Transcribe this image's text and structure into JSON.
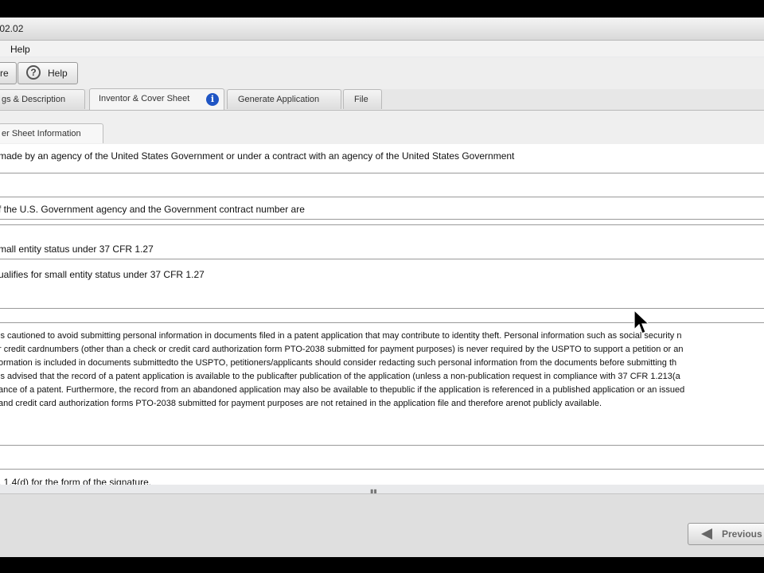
{
  "window": {
    "title": ".02.02"
  },
  "menu": {
    "help": "Help"
  },
  "toolbar": {
    "partial_button": "re",
    "help_button": "Help",
    "help_glyph": "?"
  },
  "tabs": {
    "drawings": "gs & Description",
    "inventor": "Inventor & Cover Sheet",
    "generate": "Generate Application",
    "file": "File",
    "info_glyph": "i"
  },
  "subtab": {
    "label": "er Sheet Information"
  },
  "content": {
    "gov_statement": "made by an agency of the United States Government or under a contract with an agency of the United States Government",
    "gov_agency": "f the U.S. Government agency and the Government contract number are",
    "small_entity": "mall entity status under 37 CFR 1.27",
    "qualifies": "ualifies for small entity status under 37 CFR 1.27",
    "privacy": [
      " is cautioned to avoid submitting personal information in documents filed in a patent application that may contribute to identity theft. Personal information such as social security n",
      "r credit cardnumbers (other than a check or credit card authorization form PTO-2038 submitted for payment purposes) is never required by the USPTO to support a petition or an",
      "ormation is included in documents submittedto the USPTO, petitioners/applicants should consider redacting such personal information from the documents before submitting th",
      " is advised that the record of a patent application is available to the publicafter publication of the application (unless a non-publication request in compliance with 37 CFR 1.213(a",
      "ance of a patent. Furthermore, the record from an abandoned application may also be available to thepublic if the application is referenced in a published application or an issued",
      "and credit card authorization forms PTO-2038 submitted for payment purposes are not retained in the application file and therefore arenot publicly available."
    ],
    "signature": ". 1.4(d) for the form of the signature."
  },
  "footer": {
    "previous": "Previous"
  }
}
